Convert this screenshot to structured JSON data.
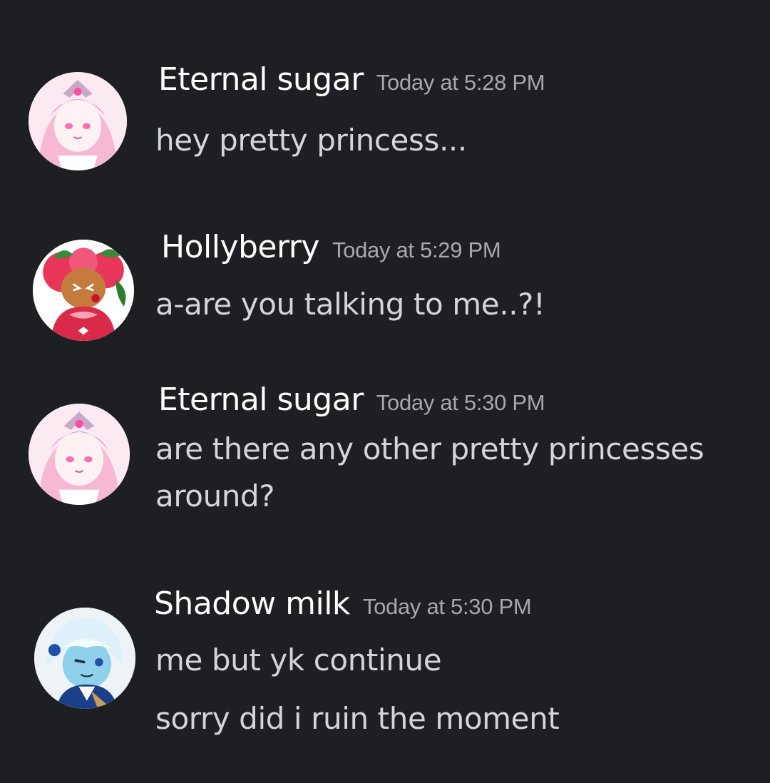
{
  "messages": [
    {
      "username": "Eternal sugar",
      "timestamp": "Today at 5:28 PM",
      "lines": [
        "hey pretty princess..."
      ],
      "avatar_icon": "eternal-sugar-avatar"
    },
    {
      "username": "Hollyberry",
      "timestamp": "Today at 5:29 PM",
      "lines": [
        "a-are you talking to me..?!"
      ],
      "avatar_icon": "hollyberry-avatar"
    },
    {
      "username": "Eternal sugar",
      "timestamp": "Today at 5:30 PM",
      "lines": [
        "are there any other pretty princesses",
        "around?"
      ],
      "avatar_icon": "eternal-sugar-avatar"
    },
    {
      "username": "Shadow milk",
      "timestamp": "Today at 5:30 PM",
      "lines": [
        "me but yk continue",
        "sorry did i ruin the moment"
      ],
      "avatar_icon": "shadow-milk-avatar"
    }
  ],
  "colors": {
    "background": "#1e1f22",
    "username": "#ffffff",
    "timestamp": "#a5a8ae",
    "message_text": "#d2d5d9"
  }
}
